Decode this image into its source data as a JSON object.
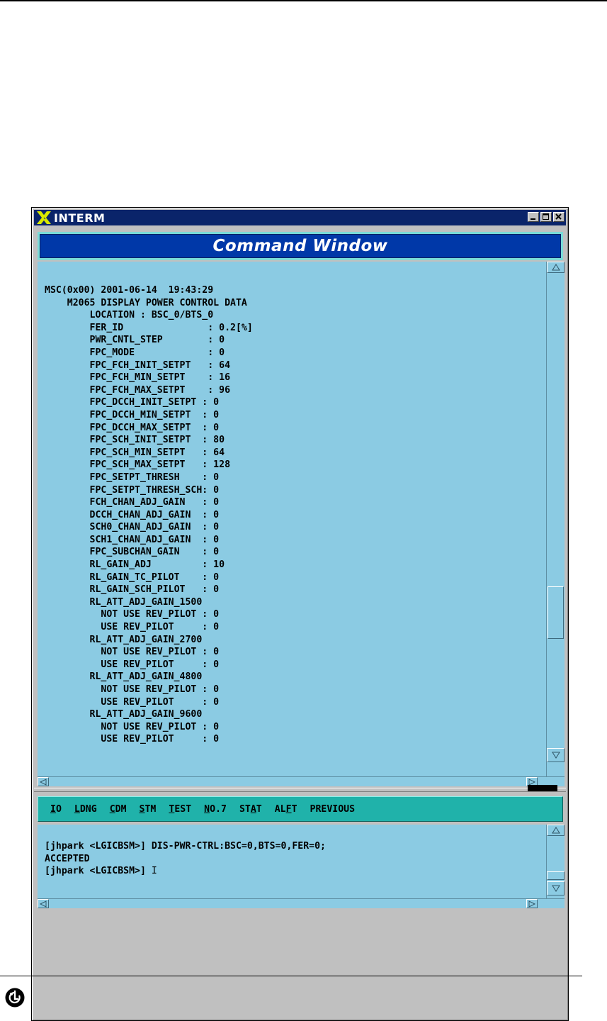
{
  "window": {
    "title": "INTERM"
  },
  "header": {
    "title": "Command Window"
  },
  "output": {
    "lines": [
      "MSC(0x00) 2001-06-14  19:43:29",
      "    M2065 DISPLAY POWER CONTROL DATA",
      "        LOCATION : BSC_0/BTS_0",
      "        FER_ID               : 0.2[%]",
      "        PWR_CNTL_STEP        : 0",
      "        FPC_MODE             : 0",
      "        FPC_FCH_INIT_SETPT   : 64",
      "        FPC_FCH_MIN_SETPT    : 16",
      "        FPC_FCH_MAX_SETPT    : 96",
      "        FPC_DCCH_INIT_SETPT : 0",
      "        FPC_DCCH_MIN_SETPT  : 0",
      "        FPC_DCCH_MAX_SETPT  : 0",
      "        FPC_SCH_INIT_SETPT  : 80",
      "        FPC_SCH_MIN_SETPT   : 64",
      "        FPC_SCH_MAX_SETPT   : 128",
      "        FPC_SETPT_THRESH    : 0",
      "        FPC_SETPT_THRESH_SCH: 0",
      "        FCH_CHAN_ADJ_GAIN   : 0",
      "        DCCH_CHAN_ADJ_GAIN  : 0",
      "        SCH0_CHAN_ADJ_GAIN  : 0",
      "        SCH1_CHAN_ADJ_GAIN  : 0",
      "        FPC_SUBCHAN_GAIN    : 0",
      "        RL_GAIN_ADJ         : 10",
      "        RL_GAIN_TC_PILOT    : 0",
      "        RL_GAIN_SCH_PILOT   : 0",
      "        RL_ATT_ADJ_GAIN_1500",
      "          NOT USE REV_PILOT : 0",
      "          USE REV_PILOT     : 0",
      "        RL_ATT_ADJ_GAIN_2700",
      "          NOT USE REV_PILOT : 0",
      "          USE REV_PILOT     : 0",
      "        RL_ATT_ADJ_GAIN_4800",
      "          NOT USE REV_PILOT : 0",
      "          USE REV_PILOT     : 0",
      "        RL_ATT_ADJ_GAIN_9600",
      "          NOT USE REV_PILOT : 0",
      "          USE REV_PILOT     : 0"
    ]
  },
  "menu": {
    "items": [
      {
        "label": "IO"
      },
      {
        "label": "LDNG"
      },
      {
        "label": "CDM"
      },
      {
        "label": "STM"
      },
      {
        "label": "TEST"
      },
      {
        "label": "NO.7"
      },
      {
        "label": "STAT"
      },
      {
        "label": "ALFT"
      },
      {
        "label": "PREVIOUS"
      }
    ]
  },
  "input": {
    "lines": [
      "[jhpark <LGICBSM>] DIS-PWR-CTRL:BSC=0,BTS=0,FER=0;",
      "ACCEPTED"
    ],
    "prompt": "[jhpark <LGICBSM>]",
    "caret": "I"
  },
  "colors": {
    "titlebar": "#0a246a",
    "banner": "#0038a8",
    "banner_frame": "#7adbd8",
    "pane": "#8bcbe3",
    "menubar": "#20b2aa"
  }
}
